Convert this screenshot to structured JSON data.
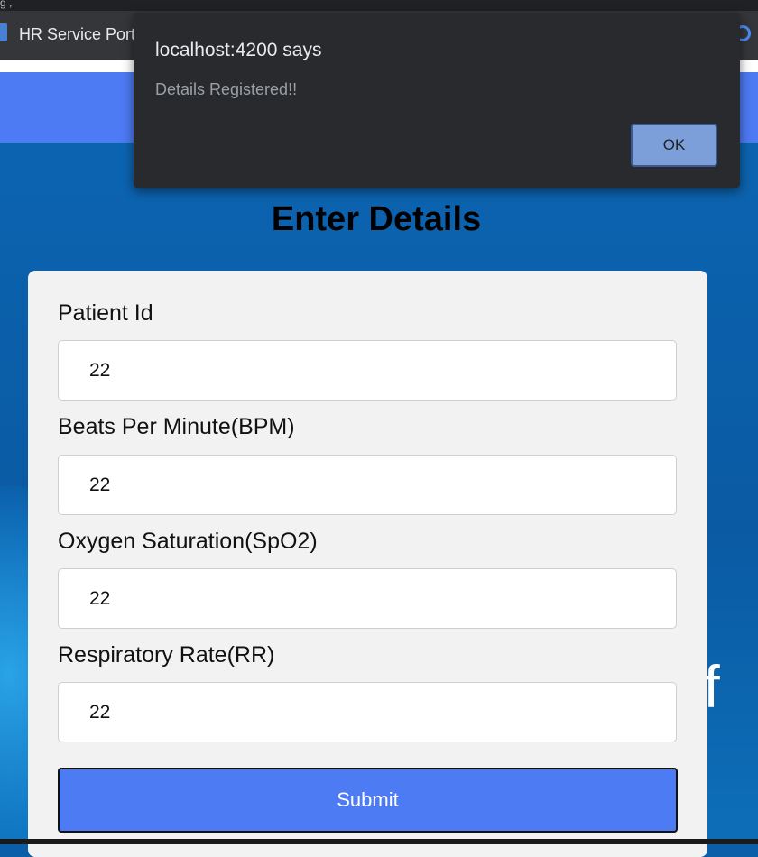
{
  "browser": {
    "corner_text": "g ,",
    "tab_title": "HR Service Porta"
  },
  "page": {
    "heading": "Enter Details",
    "background_text": "lif"
  },
  "form": {
    "fields": [
      {
        "label": "Patient Id",
        "value": "22"
      },
      {
        "label": "Beats Per Minute(BPM)",
        "value": "22"
      },
      {
        "label": "Oxygen Saturation(SpO2)",
        "value": "22"
      },
      {
        "label": "Respiratory Rate(RR)",
        "value": "22"
      }
    ],
    "submit_label": "Submit"
  },
  "dialog": {
    "title": "localhost:4200 says",
    "message": "Details Registered!!",
    "ok_label": "OK"
  },
  "colors": {
    "navbar": "#4d7bf3",
    "hero_background": "#0a5fa8",
    "card_background": "#f2f2f2",
    "submit_button": "#4d7bf3",
    "dialog_background": "#292a2d",
    "dialog_ok_button": "#7c9fd9"
  },
  "icons": {
    "tab_favicon": "shield-icon",
    "tab_right": "profile-circle-icon"
  }
}
